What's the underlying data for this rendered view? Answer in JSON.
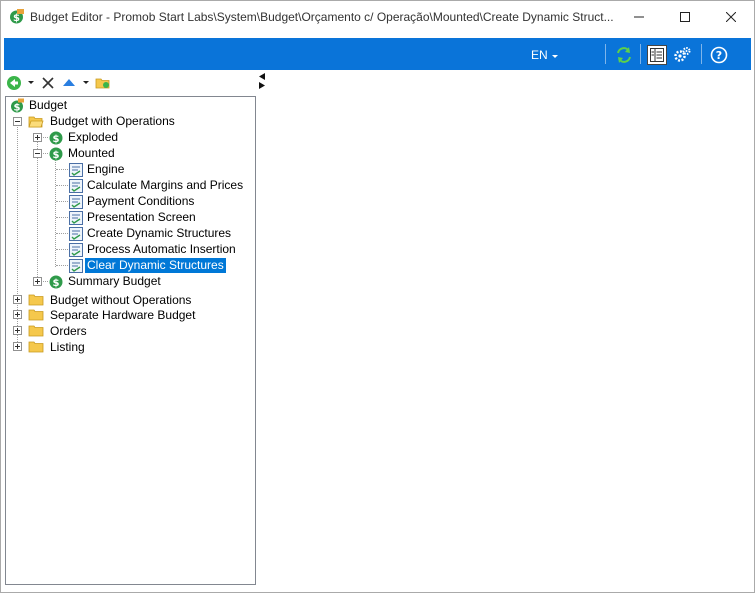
{
  "window": {
    "title": "Budget Editor - Promob Start Labs\\System\\Budget\\Orçamento c/ Operação\\Mounted\\Create Dynamic Struct..."
  },
  "topbar": {
    "language": "EN"
  },
  "icons": {
    "refresh": "refresh-icon",
    "layout": "layout-icon",
    "settings": "gears-icon",
    "help": "help-icon"
  },
  "colors": {
    "accent": "#0a74d9",
    "selection": "#0078d7",
    "folder": "#f5c84c",
    "dollar": "#2f9a4a"
  },
  "tree": {
    "root": "Budget",
    "with_operations": "Budget with Operations",
    "exploded": "Exploded",
    "mounted": "Mounted",
    "mounted_items": [
      "Engine",
      "Calculate Margins and Prices",
      "Payment Conditions",
      "Presentation Screen",
      "Create Dynamic Structures",
      "Process Automatic Insertion",
      "Clear Dynamic Structures"
    ],
    "summary": "Summary Budget",
    "without_operations": "Budget without Operations",
    "hardware": "Separate Hardware Budget",
    "orders": "Orders",
    "listing": "Listing",
    "selected_item": "Clear Dynamic Structures"
  }
}
